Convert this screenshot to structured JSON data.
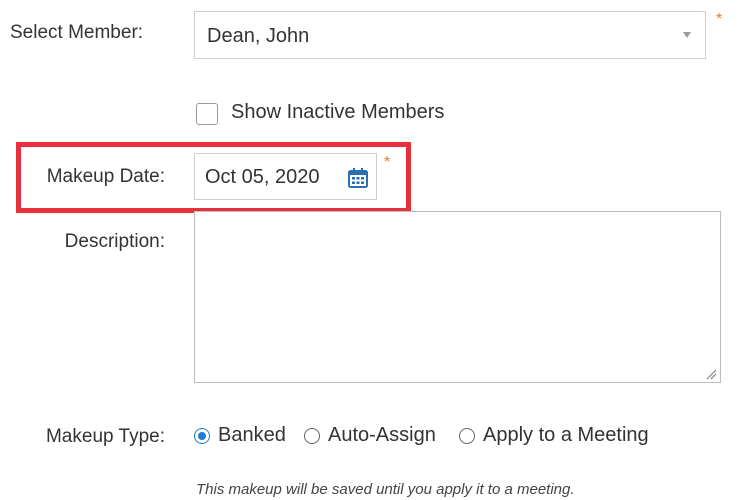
{
  "form": {
    "select_member": {
      "label": "Select Member:",
      "value": "Dean, John",
      "required_mark": "*"
    },
    "show_inactive": {
      "label": "Show Inactive Members",
      "checked": false
    },
    "makeup_date": {
      "label": "Makeup Date:",
      "value": "Oct 05, 2020",
      "required_mark": "*"
    },
    "description": {
      "label": "Description:",
      "value": ""
    },
    "makeup_type": {
      "label": "Makeup Type:",
      "options": [
        {
          "label": "Banked",
          "selected": true
        },
        {
          "label": "Auto-Assign",
          "selected": false
        },
        {
          "label": "Apply to a Meeting",
          "selected": false
        }
      ],
      "hint": "This makeup will be saved until you apply it to a meeting."
    }
  },
  "colors": {
    "highlight": "#e8303a",
    "required": "#e8792a",
    "radio_accent": "#1f7bd6",
    "calendar_icon": "#2a6fb3"
  }
}
